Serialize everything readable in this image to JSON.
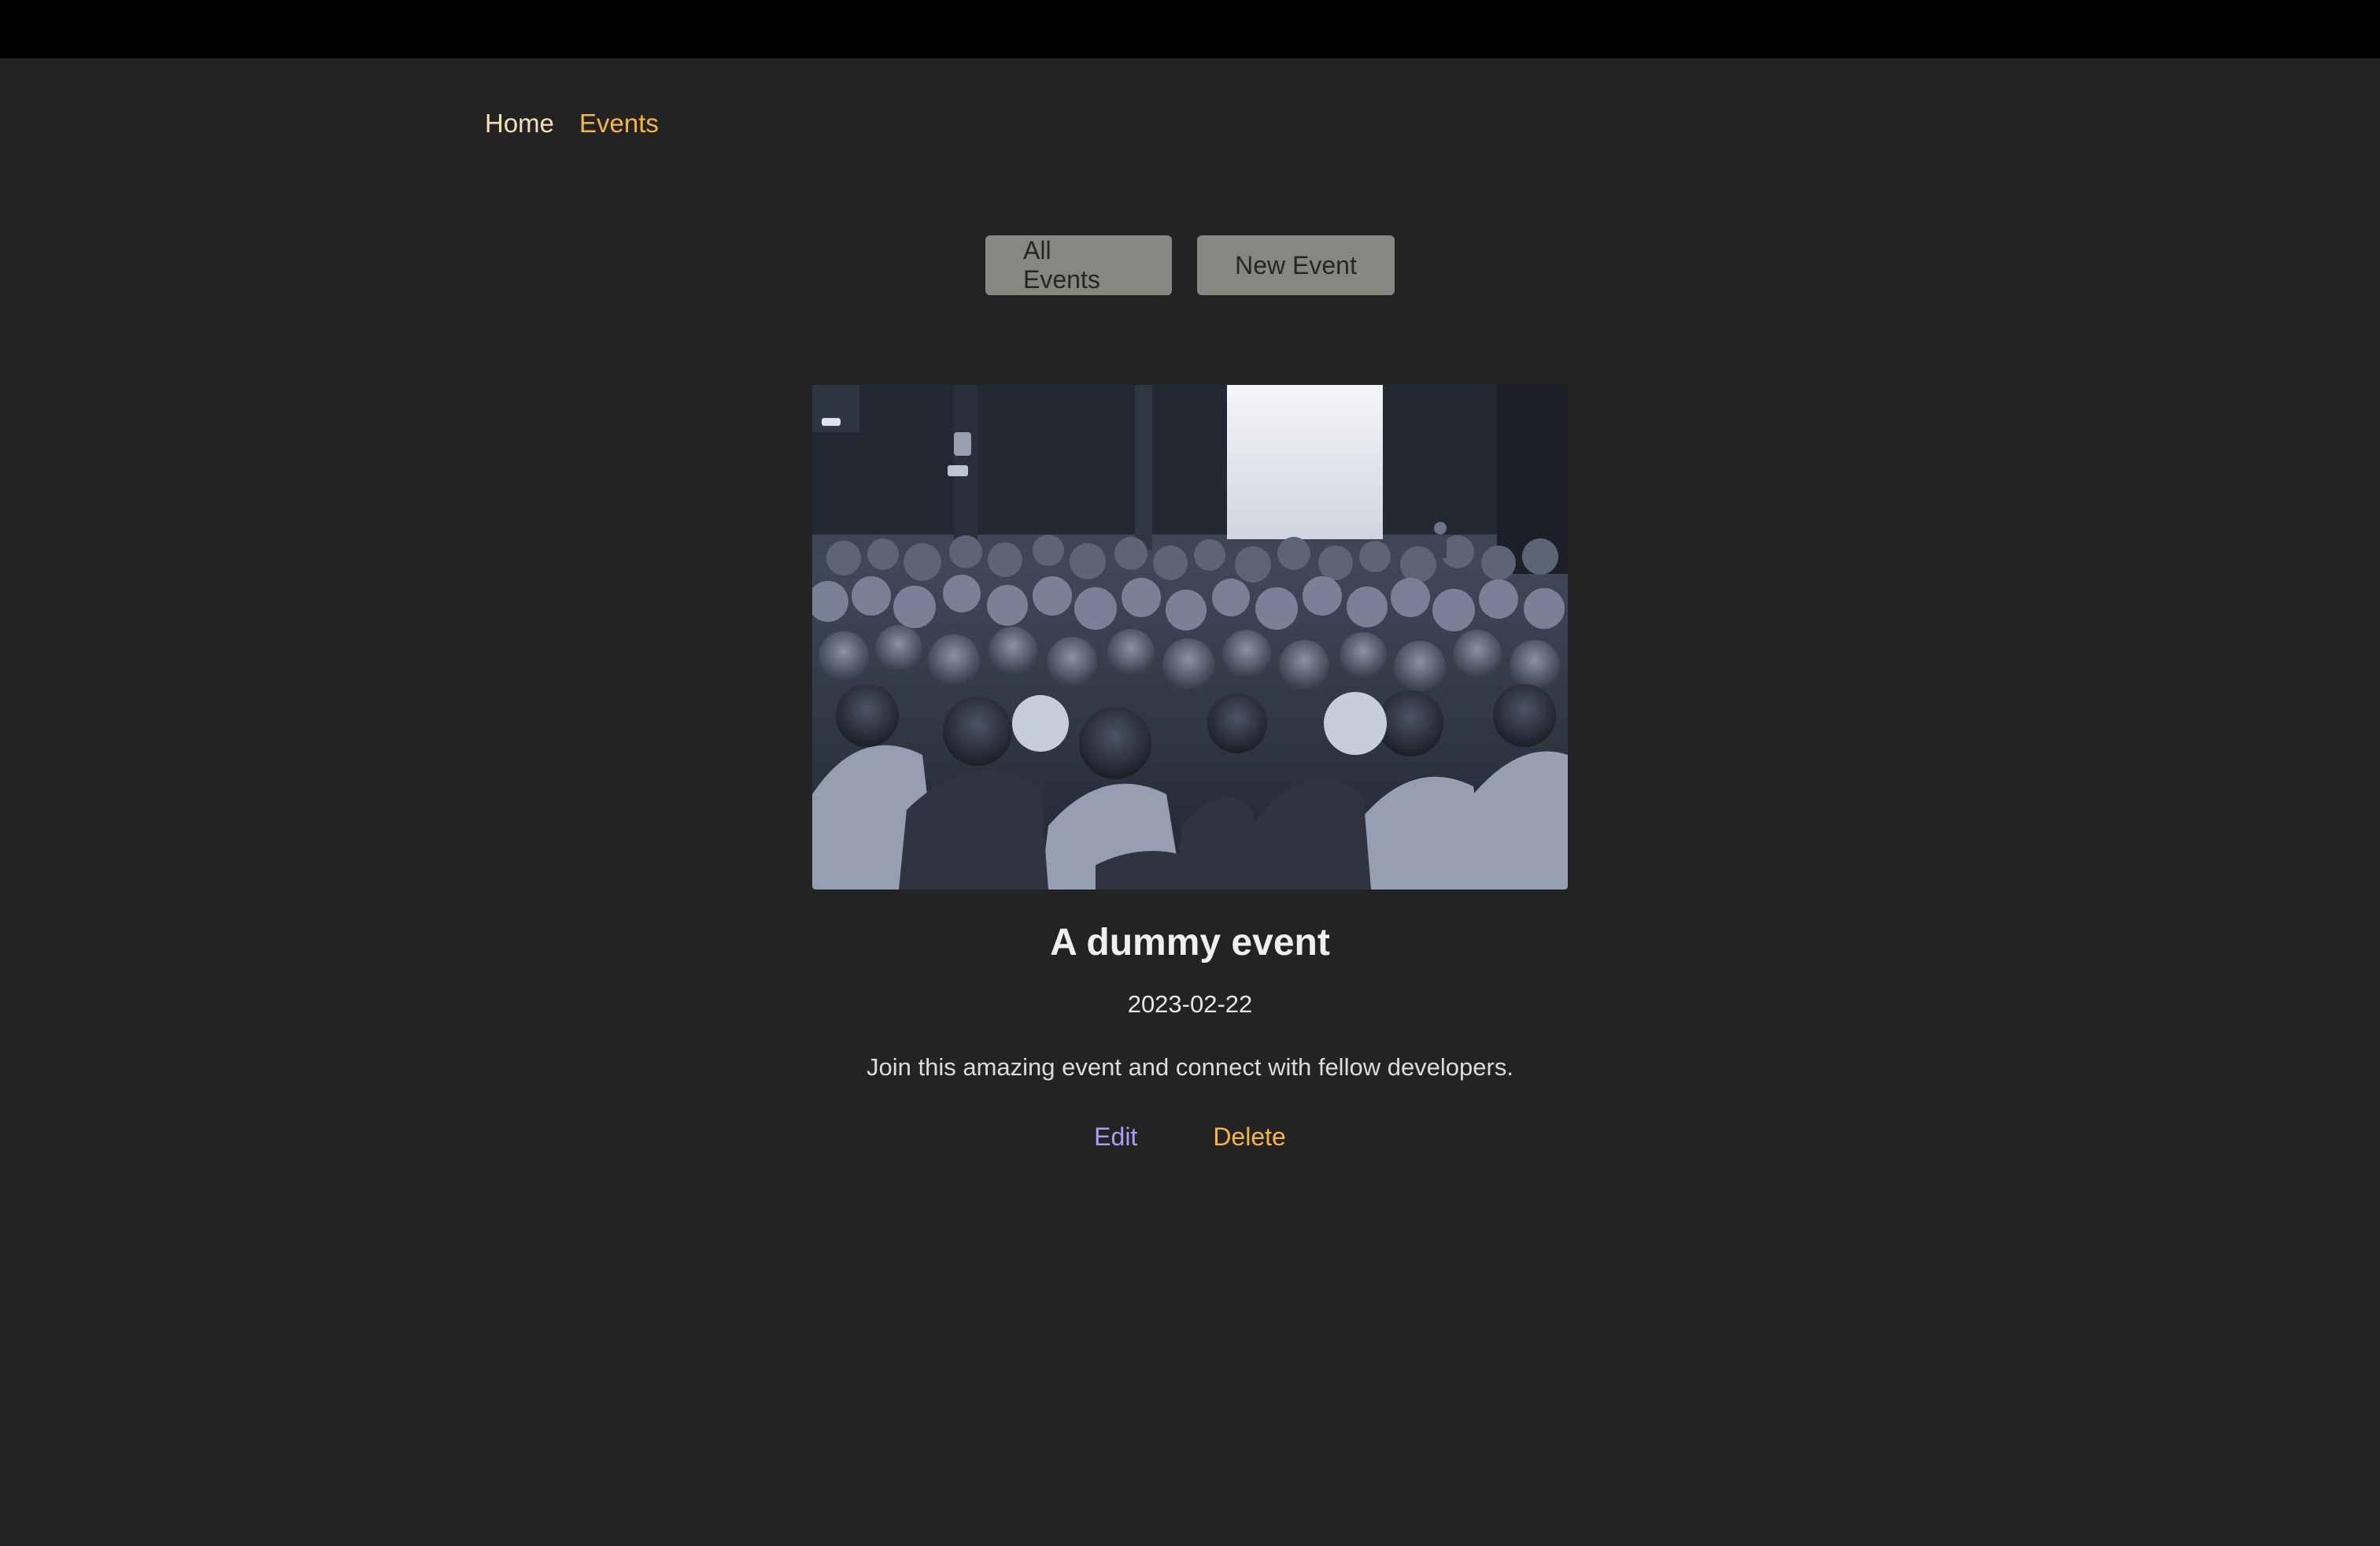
{
  "nav": {
    "home_label": "Home",
    "events_label": "Events"
  },
  "actions": {
    "all_events_label": "All Events",
    "new_event_label": "New Event"
  },
  "event": {
    "title": "A dummy event",
    "date": "2023-02-22",
    "description": "Join this amazing event and connect with fellow developers.",
    "edit_label": "Edit",
    "delete_label": "Delete"
  },
  "colors": {
    "background": "#232323",
    "top_bar": "#000000",
    "nav_home": "#f4e1b6",
    "accent_orange": "#f5b544",
    "edit_link": "#a99ef2",
    "button_bg": "#878680"
  }
}
